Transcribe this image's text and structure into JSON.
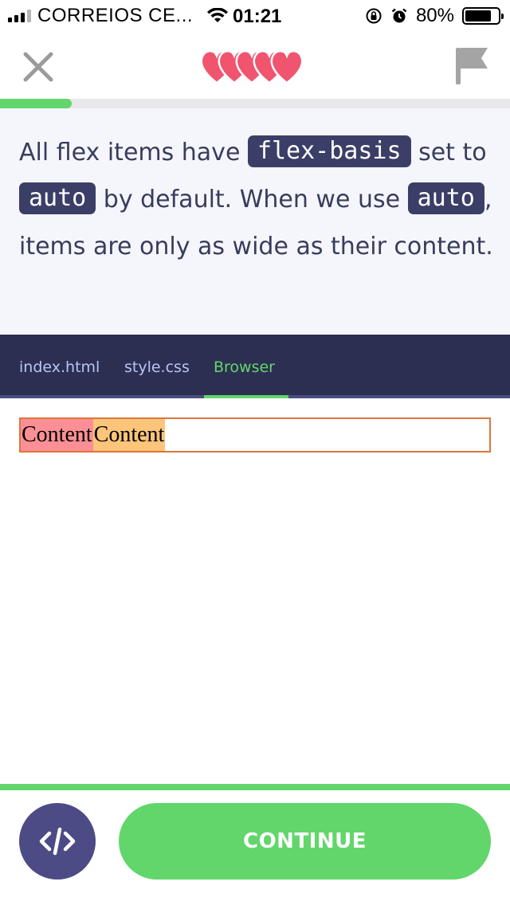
{
  "status_bar": {
    "carrier": "CORREIOS CE...",
    "time": "01:21",
    "battery": "80%",
    "battery_level": 0.8
  },
  "nav": {
    "close_icon": "close-icon",
    "lives_icon": "hearts-icon",
    "lives_count": 5,
    "flag_icon": "flag-icon",
    "progress": 0.14
  },
  "lesson": {
    "seg1": "All flex items have ",
    "code1": "flex-basis",
    "seg2": " set to ",
    "code2": "auto",
    "seg3": " by default. When we use ",
    "code3": "auto",
    "seg4": ", items are only as wide as their content."
  },
  "tabs": [
    {
      "label": "index.html",
      "active": false
    },
    {
      "label": "style.css",
      "active": false
    },
    {
      "label": "Browser",
      "active": true
    }
  ],
  "browser": {
    "item1": "Content",
    "item2": "Content"
  },
  "footer": {
    "code_icon": "code-icon",
    "continue_label": "CONTINUE"
  },
  "colors": {
    "accent_green": "#62d66b",
    "dark_navy": "#2c2f51",
    "code_bg": "#3b3f67",
    "heart_red": "#f0546e",
    "item1_bg": "#fc8f95",
    "item2_bg": "#fcc57a",
    "container_border": "#d9773e"
  }
}
